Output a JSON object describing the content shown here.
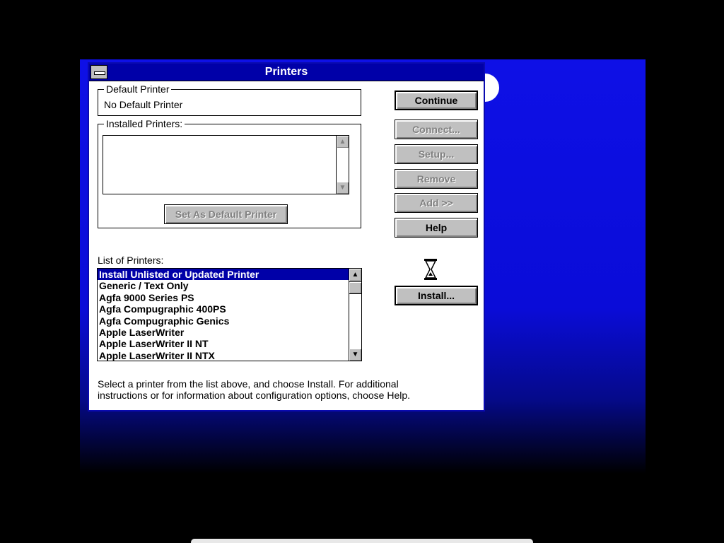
{
  "window": {
    "title": "Printers"
  },
  "default_printer": {
    "label": "Default Printer",
    "value": "No Default Printer"
  },
  "installed_printers": {
    "label": "Installed Printers:",
    "items": [],
    "set_default_label": "Set As Default Printer"
  },
  "buttons": {
    "continue": "Continue",
    "connect": "Connect...",
    "setup": "Setup...",
    "remove": "Remove",
    "add": "Add >>",
    "help": "Help",
    "install": "Install..."
  },
  "list_of_printers": {
    "label": "List of Printers:",
    "items": [
      "Install Unlisted or Updated Printer",
      "Generic / Text Only",
      "Agfa 9000 Series PS",
      "Agfa Compugraphic 400PS",
      "Agfa Compugraphic Genics",
      "Apple LaserWriter",
      "Apple LaserWriter II NT",
      "Apple LaserWriter II NTX"
    ],
    "selected_index": 0
  },
  "instructions": {
    "line1": "Select a printer from the list above, and choose Install. For additional",
    "line2": "instructions or for information about configuration options, choose Help."
  },
  "colors": {
    "titlebar": "#0000a8",
    "backdrop": "#0e10e6",
    "button_face": "#c0c0c0",
    "selection": "#0000a8"
  },
  "icons": {
    "system_menu": "system-menu-icon",
    "scroll_up": "arrow-up-icon",
    "scroll_down": "arrow-down-icon",
    "busy_cursor": "hourglass-icon"
  }
}
